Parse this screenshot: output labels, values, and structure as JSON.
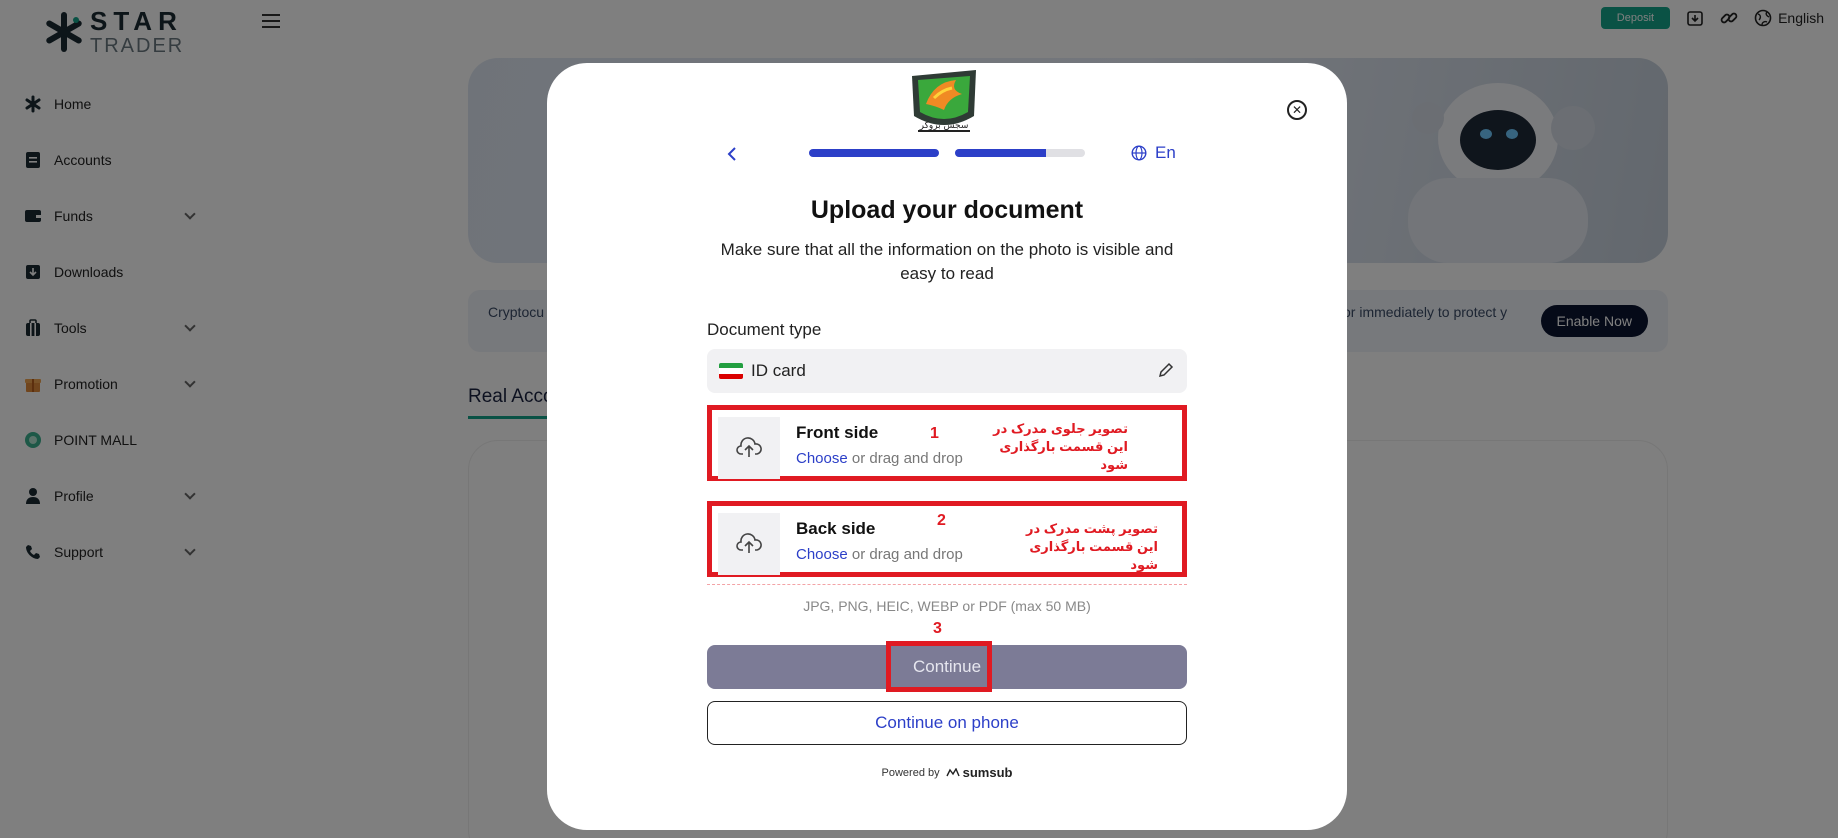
{
  "app": {
    "logo_star": "STAR",
    "logo_trader": "TRADER"
  },
  "sidebar": {
    "items": [
      {
        "label": "Home",
        "icon": "home-icon"
      },
      {
        "label": "Accounts",
        "icon": "accounts-icon"
      },
      {
        "label": "Funds",
        "icon": "wallet-icon",
        "expandable": true
      },
      {
        "label": "Downloads",
        "icon": "download-icon"
      },
      {
        "label": "Tools",
        "icon": "tools-icon",
        "expandable": true
      },
      {
        "label": "Promotion",
        "icon": "gift-icon",
        "expandable": true
      },
      {
        "label": "POINT MALL",
        "icon": "point-mall-icon"
      },
      {
        "label": "Profile",
        "icon": "user-icon",
        "expandable": true
      },
      {
        "label": "Support",
        "icon": "phone-icon",
        "expandable": true
      }
    ]
  },
  "topbar": {
    "deposit_label": "Deposit",
    "language": "English"
  },
  "background": {
    "banner_text_left": "Cryptocu our funds",
    "banner_text_right": "or immediately to protect y",
    "enable_label": "Enable Now",
    "tab_label": "Real Acco"
  },
  "modal": {
    "language": "En",
    "progress": [
      1.0,
      0.7
    ],
    "title": "Upload your document",
    "subtitle": "Make sure that all the information on the photo is visible and easy to read",
    "doc_type_label": "Document type",
    "doc_type_value": "ID card",
    "front": {
      "title": "Front side",
      "choose": "Choose",
      "rest": "or drag and drop",
      "annotation_num": "1",
      "annotation_text": "تصویر جلوی مدرک در این قسمت بارگذاری شود"
    },
    "back": {
      "title": "Back side",
      "choose": "Choose",
      "rest": "or drag and drop",
      "annotation_num": "2",
      "annotation_text": "تصویر پشت مدرک در این قسمت بارگذاری شود"
    },
    "formats": "JPG, PNG, HEIC, WEBP or PDF (max 50 MB)",
    "continue_annotation_num": "3",
    "continue_label": "Continue",
    "phone_label": "Continue on phone",
    "powered_by": "Powered by",
    "powered_brand": "sumsub",
    "colors": {
      "accent": "#2c3fc8",
      "annotation": "#e01a22",
      "deposit": "#14a58b"
    }
  }
}
